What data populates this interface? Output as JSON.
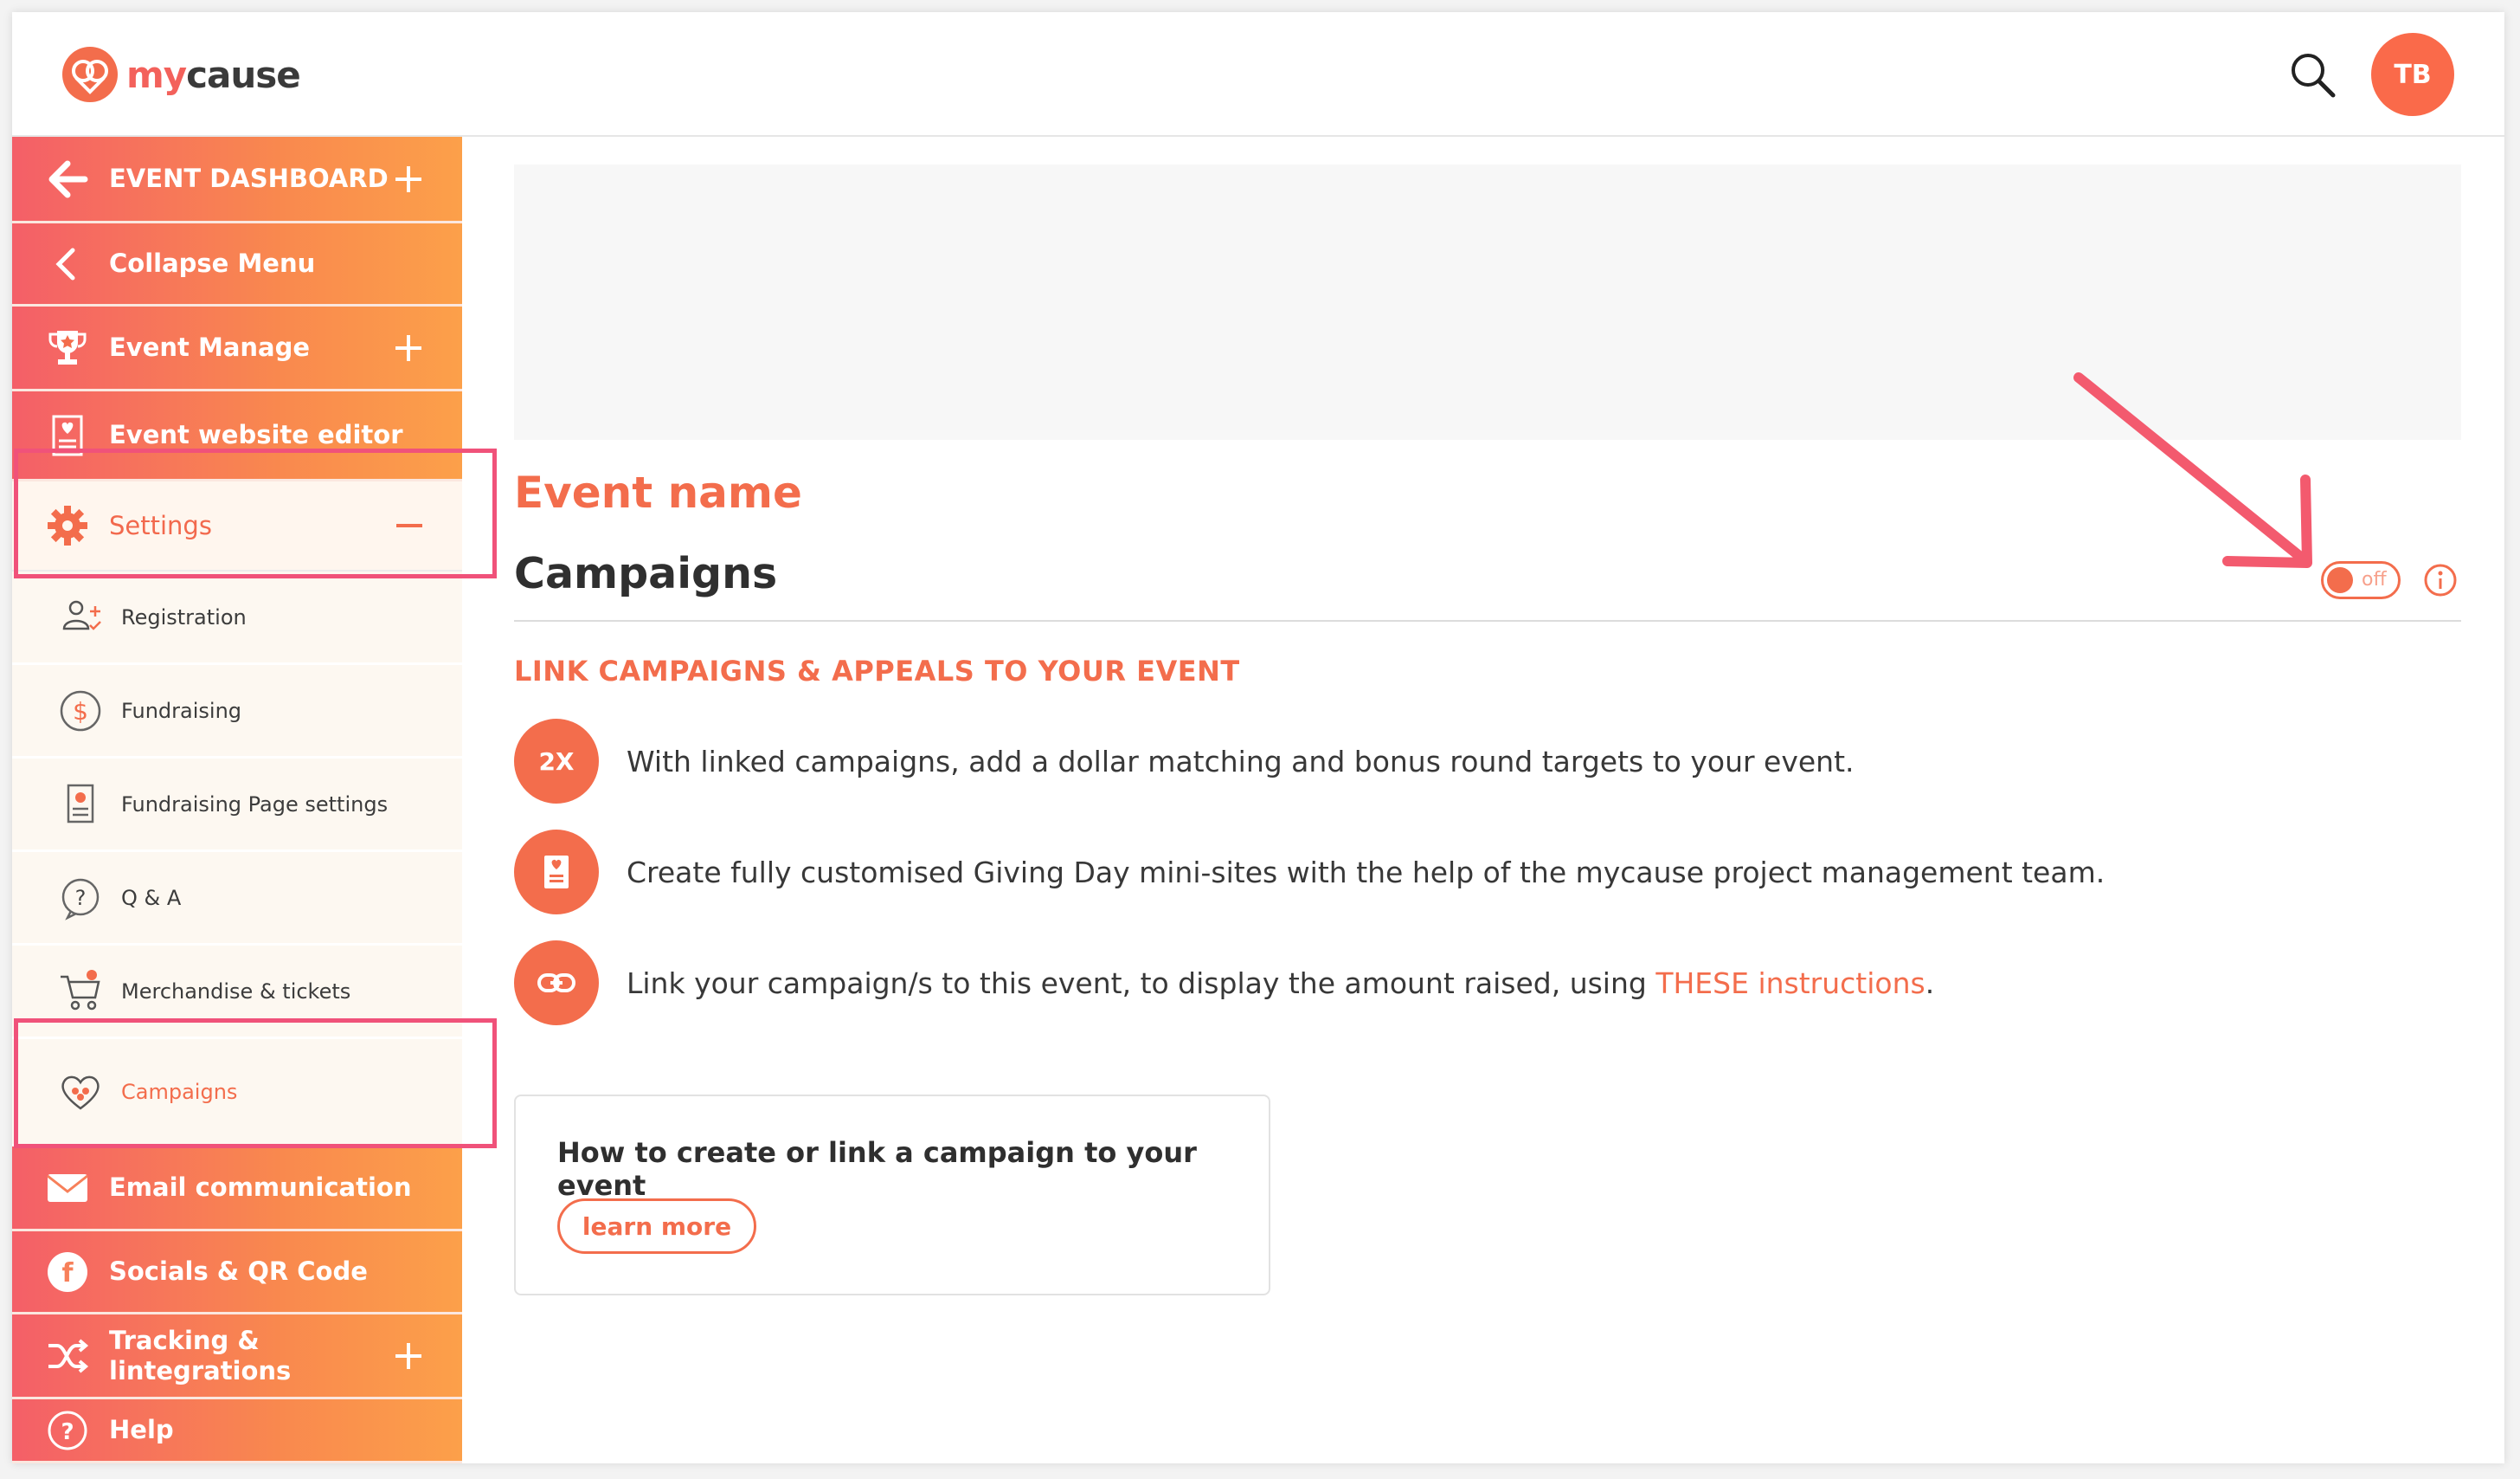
{
  "header": {
    "logo_my": "my",
    "logo_cause": "cause",
    "avatar_initials": "TB"
  },
  "sidebar": {
    "nav_top": [
      {
        "label": "EVENT DASHBOARD",
        "icon": "arrow-left-icon",
        "plus": true
      },
      {
        "label": "Collapse Menu",
        "icon": "chevron-left-icon",
        "plus": false
      },
      {
        "label": "Event Manage",
        "icon": "trophy-icon",
        "plus": true
      },
      {
        "label": "Event website editor",
        "icon": "webpage-icon",
        "plus": false
      }
    ],
    "settings": {
      "label": "Settings",
      "icon": "gear-icon",
      "expanded": true
    },
    "settings_items": [
      {
        "label": "Registration",
        "icon": "user-add-icon"
      },
      {
        "label": "Fundraising",
        "icon": "dollar-icon"
      },
      {
        "label": "Fundraising Page settings",
        "icon": "page-settings-icon"
      },
      {
        "label": "Q & A",
        "icon": "question-icon"
      },
      {
        "label": "Merchandise & tickets",
        "icon": "cart-icon"
      },
      {
        "label": "Campaigns",
        "icon": "heart-icon",
        "active": true
      }
    ],
    "nav_bottom": [
      {
        "label": "Email communication",
        "icon": "envelope-icon",
        "plus": false
      },
      {
        "label": "Socials & QR Code",
        "icon": "facebook-icon",
        "plus": false
      },
      {
        "label": "Tracking & lintegrations",
        "icon": "shuffle-icon",
        "plus": true
      },
      {
        "label": "Help",
        "icon": "help-icon",
        "plus": false
      }
    ]
  },
  "main": {
    "event_name": "Event name",
    "page_title": "Campaigns",
    "toggle_label": "off",
    "section_heading": "LINK CAMPAIGNS & APPEALS TO YOUR EVENT",
    "features": [
      {
        "badge": "2X",
        "icon": "double-match-icon",
        "text": "With linked campaigns, add a dollar matching and bonus round targets to your event."
      },
      {
        "badge": "",
        "icon": "minisite-icon",
        "text": "Create fully customised Giving Day mini-sites with the help of the mycause project management team."
      },
      {
        "badge": "",
        "icon": "link-icon",
        "text_before": "Link your campaign/s to this event, to display the amount raised, using ",
        "link_text": "THESE instructions",
        "text_after": "."
      }
    ],
    "card": {
      "title": "How to create or link a campaign to your event",
      "button_label": "learn more"
    }
  },
  "colors": {
    "accent": "#f36d4c",
    "highlight_box": "#f0527a",
    "gradient_start": "#f45f68",
    "gradient_end": "#fca04a"
  }
}
